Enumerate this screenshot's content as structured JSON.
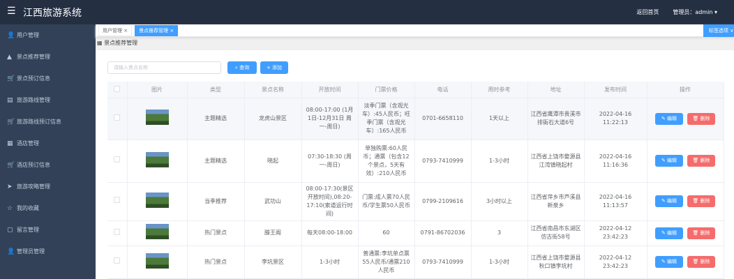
{
  "header": {
    "title": "江西旅游系统",
    "home": "返回首页",
    "user": "管理员：admin ▾"
  },
  "sidebar": {
    "items": [
      "用户管理",
      "景点推荐管理",
      "景点预订信息",
      "旅游路线管理",
      "旅游路线预订信息",
      "酒店管理",
      "酒店预订信息",
      "旅游攻略管理",
      "我的收藏",
      "留言管理",
      "管理员管理"
    ]
  },
  "tabs": {
    "items": [
      "用户管理 ×",
      "景点推荐管理 ×"
    ],
    "options": "标签选项 ∨"
  },
  "breadcrumb": "景点推荐管理",
  "search": {
    "placeholder": "请输入景点名称",
    "query": "查询",
    "add": "+ 添加"
  },
  "table": {
    "headers": [
      "图片",
      "类型",
      "景点名称",
      "开放时间",
      "门票价格",
      "电话",
      "用时参考",
      "地址",
      "发布时间",
      "操作"
    ],
    "edit": "编辑",
    "delete": "删除",
    "rows": [
      {
        "type": "主题精选",
        "name": "龙虎山景区",
        "hours": "08:00-17:00 (1月1日-12月31日 周一-周日)",
        "price": "淡季门票（含观光车）:45人民币；旺季门票（含观光车）:165人民币",
        "phone": "0701-6658110",
        "duration": "1天以上",
        "address": "江西省鹰潭市贵溪市排衙石大道6号",
        "time": "2022-04-16 11:22:13"
      },
      {
        "type": "主题精选",
        "name": "晓起",
        "hours": "07:30-18:30 (周一-周日)",
        "price": "单独购票:60人民币；通票（包含12个景点，5天有效）:210人民币",
        "phone": "0793-7410999",
        "duration": "1-3小时",
        "address": "江西省上饶市婺源县江湾镇晓起村",
        "time": "2022-04-16 11:16:36"
      },
      {
        "type": "当季推荐",
        "name": "武功山",
        "hours": "08:00-17:30(景区开放时间),08:20-17:10(索道运行时间)",
        "price": "门票:成人票70人民币/学生票50人民币",
        "phone": "0799-2109616",
        "duration": "3小时以上",
        "address": "江西省萍乡市芦溪县新泉乡",
        "time": "2022-04-16 11:13:57"
      },
      {
        "type": "热门景点",
        "name": "滕王阁",
        "hours": "每天08:00-18:00",
        "price": "60",
        "phone": "0791-86702036",
        "duration": "3",
        "address": "江西省南昌市东湖区仿古街58号",
        "time": "2022-04-12 23:42:23"
      },
      {
        "type": "热门景点",
        "name": "李坑景区",
        "hours": "1-3小时",
        "price": "普通票:李坑单点票55人民币/通票210人民币",
        "phone": "0793-7410999",
        "duration": "1-3小时",
        "address": "江西省上饶市婺源县秋口镇李坑村",
        "time": "2022-04-12 23:42:23"
      }
    ]
  }
}
